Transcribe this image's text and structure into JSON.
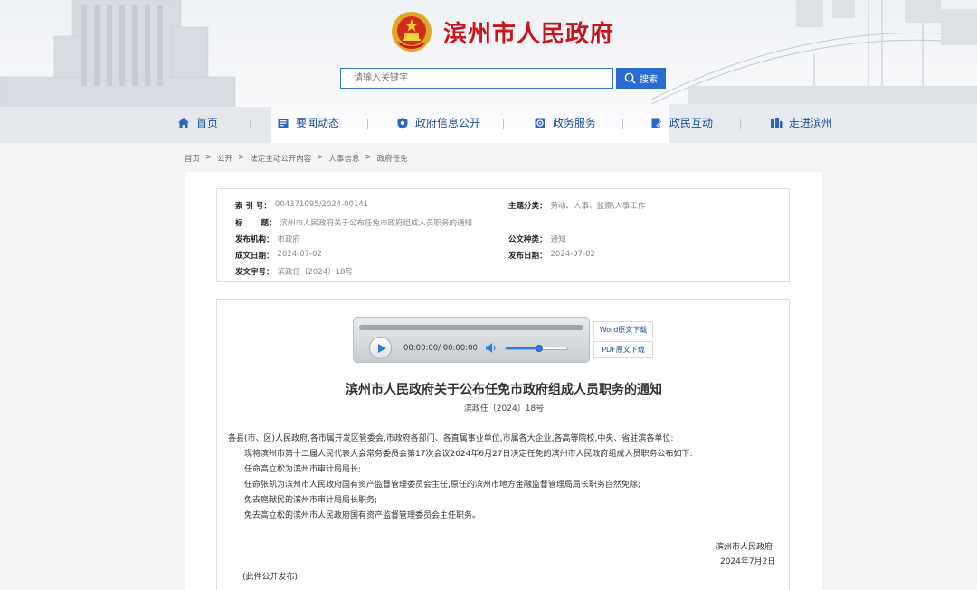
{
  "site": {
    "title": "滨州市人民政府"
  },
  "search": {
    "placeholder": "请输入关键字",
    "button_label": "搜索"
  },
  "nav": [
    {
      "label": "首页",
      "icon": "home-icon"
    },
    {
      "label": "要闻动态",
      "icon": "news-icon"
    },
    {
      "label": "政府信息公开",
      "icon": "info-icon"
    },
    {
      "label": "政务服务",
      "icon": "service-icon"
    },
    {
      "label": "政民互动",
      "icon": "interaction-icon"
    },
    {
      "label": "走进滨州",
      "icon": "building-icon"
    }
  ],
  "breadcrumb": [
    "首页",
    ">",
    "公开",
    ">",
    "法定主动公开内容",
    ">",
    "人事信息",
    ">",
    "政府任免"
  ],
  "meta": {
    "index_label": "索 引 号：",
    "index_value": "004371095/2024-00141",
    "topic_label": "主题分类：",
    "topic_value": "劳动、人事、监察\\人事工作",
    "title_label": "标 题：",
    "title_value": "滨州市人民政府关于公布任免市政府组成人员职务的通知",
    "publisher_label": "发布机构：",
    "publisher_value": "市政府",
    "doctype_label": "公文种类：",
    "doctype_value": "通知",
    "created_label": "成文日期：",
    "created_value": "2024-07-02",
    "published_label": "发布日期：",
    "published_value": "2024-07-02",
    "docno_label": "发文字号：",
    "docno_value": "滨政任〔2024〕18号"
  },
  "player": {
    "time": "00:00:00/ 00:00:00",
    "volume_level": 0.55
  },
  "downloads": {
    "word": "Word原文下载",
    "pdf": "PDF原文下载"
  },
  "document": {
    "title": "滨州市人民政府关于公布任免市政府组成人员职务的通知",
    "number": "滨政任〔2024〕18号",
    "addressee": "各县(市、区)人民政府,各市属开发区管委会,市政府各部门、各直属事业单位,市属各大企业,各高等院校,中央、省驻滨各单位:",
    "paragraphs": [
      "现将滨州市第十二届人民代表大会常务委员会第17次会议2024年6月27日决定任免的滨州市人民政府组成人员职务公布如下:",
      "任命高立松为滨州市审计局局长;",
      "任命张凯为滨州市人民政府国有资产监督管理委员会主任,原任的滨州市地方金融监督管理局局长职务自然免除;",
      "免去扈献民的滨州市审计局局长职务;",
      "免去高立松的滨州市人民政府国有资产监督管理委员会主任职务。"
    ],
    "signature": "滨州市人民政府",
    "date": "2024年7月2日",
    "note": "(此件公开发布)"
  }
}
